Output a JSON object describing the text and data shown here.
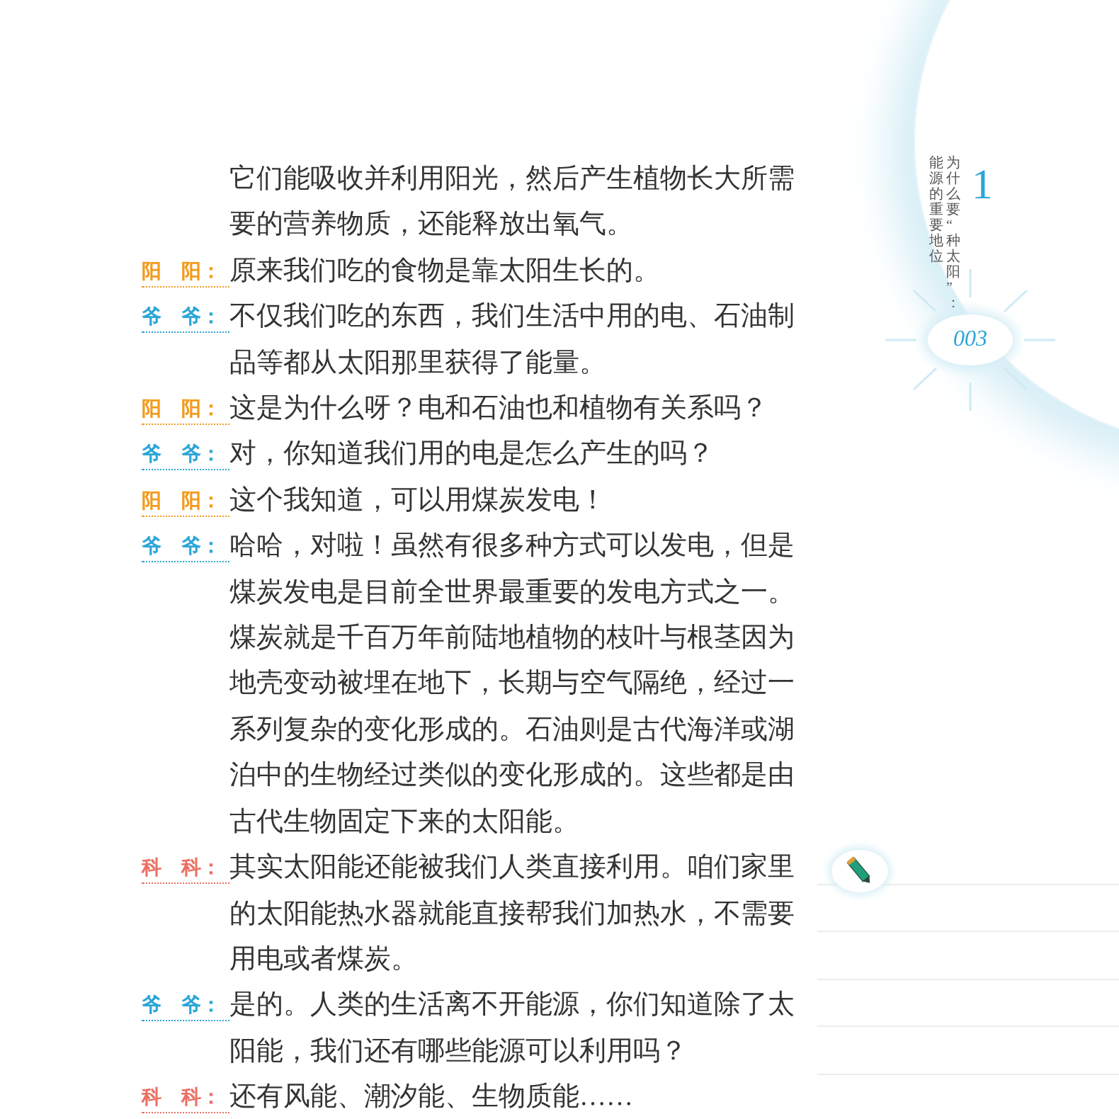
{
  "chapter": {
    "number": "1",
    "title": "为什么要“种太阳”：",
    "subtitle": "能源的重要地位",
    "page_number": "003"
  },
  "dialogue": [
    {
      "text": "它们能吸收并利用阳光，然后产生植物长大所需要的营养物质，还能释放出氧气。"
    },
    {
      "speaker": "阳　阳：",
      "color": "#f39a1c",
      "text": "原来我们吃的食物是靠太阳生长的。"
    },
    {
      "speaker": "爷　爷：",
      "color": "#2aa6d6",
      "text": "不仅我们吃的东西，我们生活中用的电、石油制品等都从太阳那里获得了能量。"
    },
    {
      "speaker": "阳　阳：",
      "color": "#f39a1c",
      "text": "这是为什么呀？电和石油也和植物有关系吗？"
    },
    {
      "speaker": "爷　爷：",
      "color": "#2aa6d6",
      "text": "对，你知道我们用的电是怎么产生的吗？"
    },
    {
      "speaker": "阳　阳：",
      "color": "#f39a1c",
      "text": "这个我知道，可以用煤炭发电！"
    },
    {
      "speaker": "爷　爷：",
      "color": "#2aa6d6",
      "text": "哈哈，对啦！虽然有很多种方式可以发电，但是煤炭发电是目前全世界最重要的发电方式之一。煤炭就是千百万年前陆地植物的枝叶与根茎因为地壳变动被埋在地下，长期与空气隔绝，经过一系列复杂的变化形成的。石油则是古代海洋或湖泊中的生物经过类似的变化形成的。这些都是由古代生物固定下来的太阳能。"
    },
    {
      "speaker": "科　科：",
      "color": "#ec6f63",
      "text": "其实太阳能还能被我们人类直接利用。咱们家里的太阳能热水器就能直接帮我们加热水，不需要用电或者煤炭。"
    },
    {
      "speaker": "爷　爷：",
      "color": "#2aa6d6",
      "text": "是的。人类的生活离不开能源，你们知道除了太阳能，我们还有哪些能源可以利用吗？"
    },
    {
      "speaker": "科　科：",
      "color": "#ec6f63",
      "text": "还有风能、潮汐能、生物质能……"
    }
  ]
}
